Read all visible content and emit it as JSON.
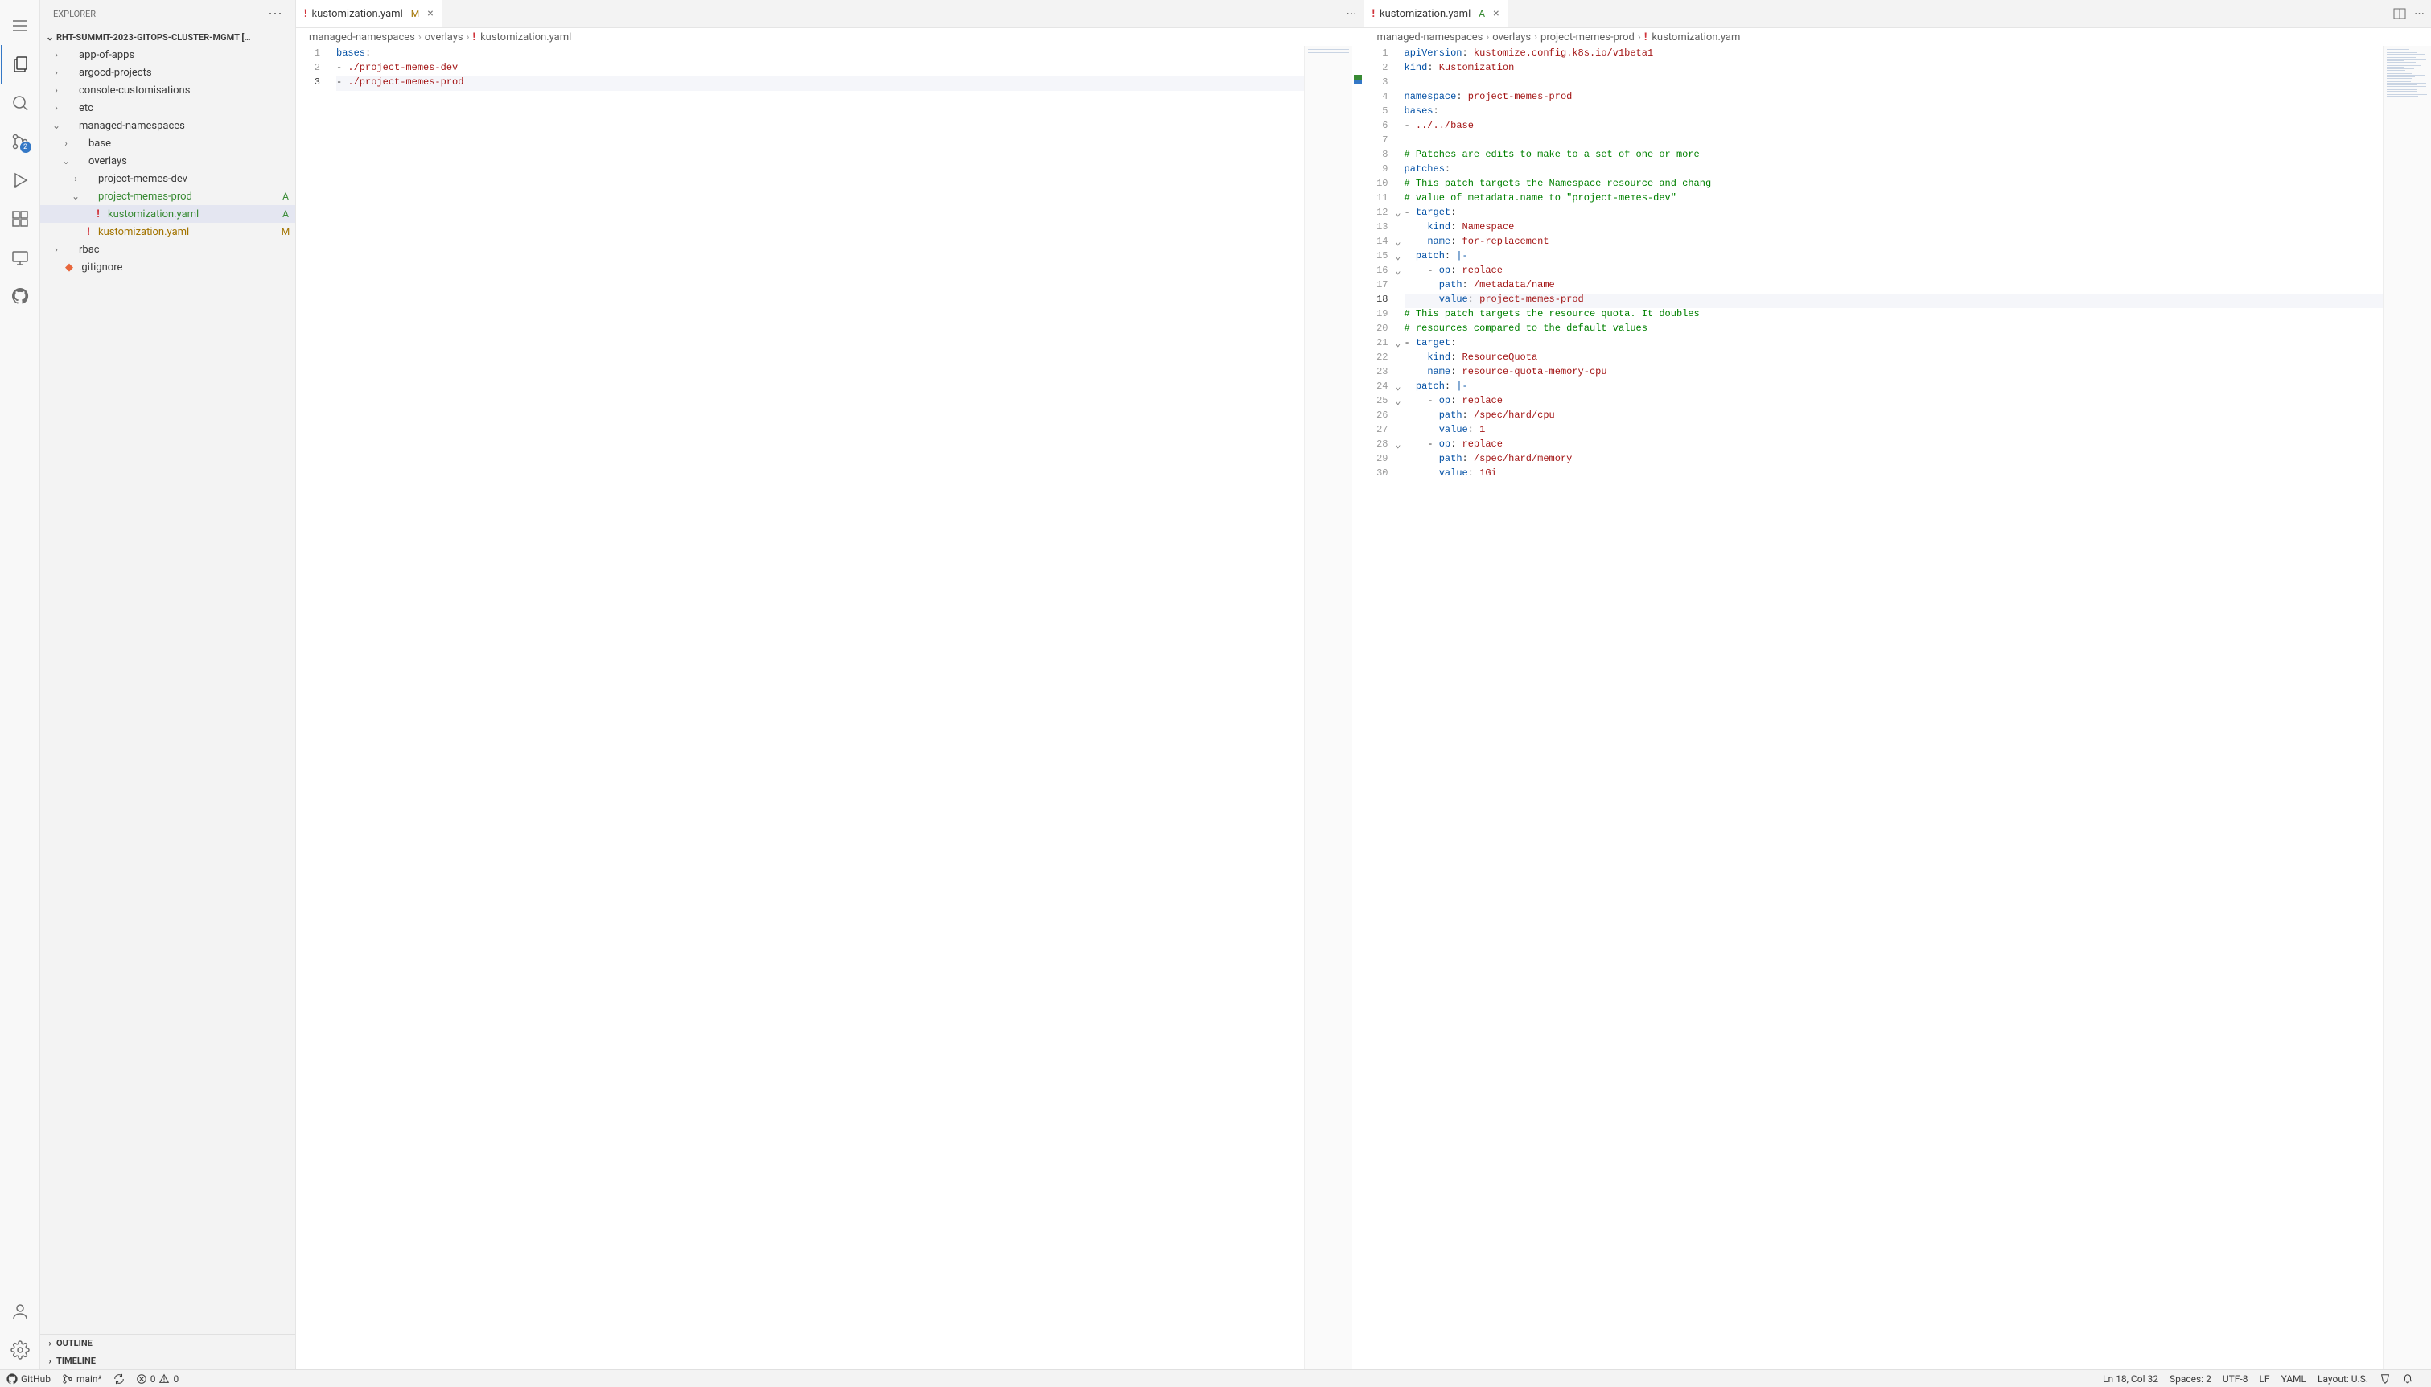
{
  "sidebar": {
    "title": "EXPLORER",
    "project": "RHT-SUMMIT-2023-GITOPS-CLUSTER-MGMT […",
    "outline": "OUTLINE",
    "timeline": "TIMELINE"
  },
  "scm_badge": "2",
  "tree": [
    {
      "depth": 0,
      "chev": "›",
      "label": "app-of-apps",
      "type": "folder"
    },
    {
      "depth": 0,
      "chev": "›",
      "label": "argocd-projects",
      "type": "folder"
    },
    {
      "depth": 0,
      "chev": "›",
      "label": "console-customisations",
      "type": "folder"
    },
    {
      "depth": 0,
      "chev": "›",
      "label": "etc",
      "type": "folder"
    },
    {
      "depth": 0,
      "chev": "⌄",
      "label": "managed-namespaces",
      "type": "folder"
    },
    {
      "depth": 1,
      "chev": "›",
      "label": "base",
      "type": "folder"
    },
    {
      "depth": 1,
      "chev": "⌄",
      "label": "overlays",
      "type": "folder"
    },
    {
      "depth": 2,
      "chev": "›",
      "label": "project-memes-dev",
      "type": "folder"
    },
    {
      "depth": 2,
      "chev": "⌄",
      "label": "project-memes-prod",
      "type": "folder",
      "git": "A",
      "gitClass": "git-added"
    },
    {
      "depth": 3,
      "chev": "",
      "label": "kustomization.yaml",
      "type": "yaml",
      "git": "A",
      "gitClass": "git-added",
      "selected": true
    },
    {
      "depth": 2,
      "chev": "",
      "label": "kustomization.yaml",
      "type": "yaml",
      "git": "M",
      "gitClass": "git-modified"
    },
    {
      "depth": 0,
      "chev": "›",
      "label": "rbac",
      "type": "folder"
    },
    {
      "depth": 0,
      "chev": "",
      "label": ".gitignore",
      "type": "git"
    }
  ],
  "editor_left": {
    "tab": {
      "name": "kustomization.yaml",
      "status": "M",
      "statusClass": "git-modified"
    },
    "breadcrumb": [
      "managed-namespaces",
      "overlays",
      "kustomization.yaml"
    ],
    "lines": [
      {
        "n": 1,
        "html": "<span class='tk-key'>bases</span><span class='tk-punc'>:</span>"
      },
      {
        "n": 2,
        "html": "<span class='tk-punc'>- </span><span class='tk-str'>./project-memes-dev</span>"
      },
      {
        "n": 3,
        "html": "<span class='tk-punc'>- </span><span class='tk-str'>./project-memes-prod</span>",
        "hl": true
      }
    ]
  },
  "editor_right": {
    "tab": {
      "name": "kustomization.yaml",
      "status": "A",
      "statusClass": "git-added"
    },
    "breadcrumb": [
      "managed-namespaces",
      "overlays",
      "project-memes-prod",
      "kustomization.yam"
    ],
    "current_line": 18,
    "folds": [
      12,
      14,
      15,
      16,
      21,
      24,
      25,
      28
    ],
    "lines": [
      {
        "n": 1,
        "html": "<span class='tk-key'>apiVersion</span><span class='tk-punc'>:</span> <span class='tk-str'>kustomize.config.k8s.io/v1beta1</span>"
      },
      {
        "n": 2,
        "html": "<span class='tk-key'>kind</span><span class='tk-punc'>:</span> <span class='tk-str'>Kustomization</span>"
      },
      {
        "n": 3,
        "html": ""
      },
      {
        "n": 4,
        "html": "<span class='tk-key'>namespace</span><span class='tk-punc'>:</span> <span class='tk-str'>project-memes-prod</span>"
      },
      {
        "n": 5,
        "html": "<span class='tk-key'>bases</span><span class='tk-punc'>:</span>"
      },
      {
        "n": 6,
        "html": "<span class='tk-punc'>- </span><span class='tk-str'>../../base</span>"
      },
      {
        "n": 7,
        "html": ""
      },
      {
        "n": 8,
        "html": "<span class='tk-com'># Patches are edits to make to a set of one or more </span>"
      },
      {
        "n": 9,
        "html": "<span class='tk-key'>patches</span><span class='tk-punc'>:</span>"
      },
      {
        "n": 10,
        "html": "<span class='tk-com'># This patch targets the Namespace resource and chang</span>"
      },
      {
        "n": 11,
        "html": "<span class='tk-com'># value of metadata.name to \"project-memes-dev\"</span>"
      },
      {
        "n": 12,
        "html": "<span class='tk-punc'>- </span><span class='tk-key'>target</span><span class='tk-punc'>:</span>"
      },
      {
        "n": 13,
        "html": "    <span class='tk-key'>kind</span><span class='tk-punc'>:</span> <span class='tk-str'>Namespace</span>"
      },
      {
        "n": 14,
        "html": "    <span class='tk-key'>name</span><span class='tk-punc'>:</span> <span class='tk-str'>for-replacement</span>"
      },
      {
        "n": 15,
        "html": "  <span class='tk-key'>patch</span><span class='tk-punc'>:</span> <span class='tk-key'>|-</span>"
      },
      {
        "n": 16,
        "html": "    <span class='tk-punc'>- </span><span class='tk-key'>op</span><span class='tk-punc'>:</span> <span class='tk-str'>replace</span>"
      },
      {
        "n": 17,
        "html": "      <span class='tk-key'>path</span><span class='tk-punc'>:</span> <span class='tk-str'>/metadata/name</span>"
      },
      {
        "n": 18,
        "html": "      <span class='tk-key'>value</span><span class='tk-punc'>:</span> <span class='tk-str'>project-memes-prod</span>",
        "hl": true
      },
      {
        "n": 19,
        "html": "<span class='tk-com'># This patch targets the resource quota. It doubles </span>"
      },
      {
        "n": 20,
        "html": "<span class='tk-com'># resources compared to the default values</span>"
      },
      {
        "n": 21,
        "html": "<span class='tk-punc'>- </span><span class='tk-key'>target</span><span class='tk-punc'>:</span>"
      },
      {
        "n": 22,
        "html": "    <span class='tk-key'>kind</span><span class='tk-punc'>:</span> <span class='tk-str'>ResourceQuota</span>"
      },
      {
        "n": 23,
        "html": "    <span class='tk-key'>name</span><span class='tk-punc'>:</span> <span class='tk-str'>resource-quota-memory-cpu</span>"
      },
      {
        "n": 24,
        "html": "  <span class='tk-key'>patch</span><span class='tk-punc'>:</span> <span class='tk-key'>|-</span>"
      },
      {
        "n": 25,
        "html": "    <span class='tk-punc'>- </span><span class='tk-key'>op</span><span class='tk-punc'>:</span> <span class='tk-str'>replace</span>"
      },
      {
        "n": 26,
        "html": "      <span class='tk-key'>path</span><span class='tk-punc'>:</span> <span class='tk-str'>/spec/hard/cpu</span>"
      },
      {
        "n": 27,
        "html": "      <span class='tk-key'>value</span><span class='tk-punc'>:</span> <span class='tk-str'>1</span>"
      },
      {
        "n": 28,
        "html": "    <span class='tk-punc'>- </span><span class='tk-key'>op</span><span class='tk-punc'>:</span> <span class='tk-str'>replace</span>"
      },
      {
        "n": 29,
        "html": "      <span class='tk-key'>path</span><span class='tk-punc'>:</span> <span class='tk-str'>/spec/hard/memory</span>"
      },
      {
        "n": 30,
        "html": "      <span class='tk-key'>value</span><span class='tk-punc'>:</span> <span class='tk-str'>1Gi</span>"
      }
    ]
  },
  "status": {
    "github": "GitHub",
    "branch": "main*",
    "errors": "0",
    "warnings": "0",
    "cursor": "Ln 18, Col 32",
    "spaces": "Spaces: 2",
    "encoding": "UTF-8",
    "eol": "LF",
    "lang": "YAML",
    "layout": "Layout: U.S."
  }
}
